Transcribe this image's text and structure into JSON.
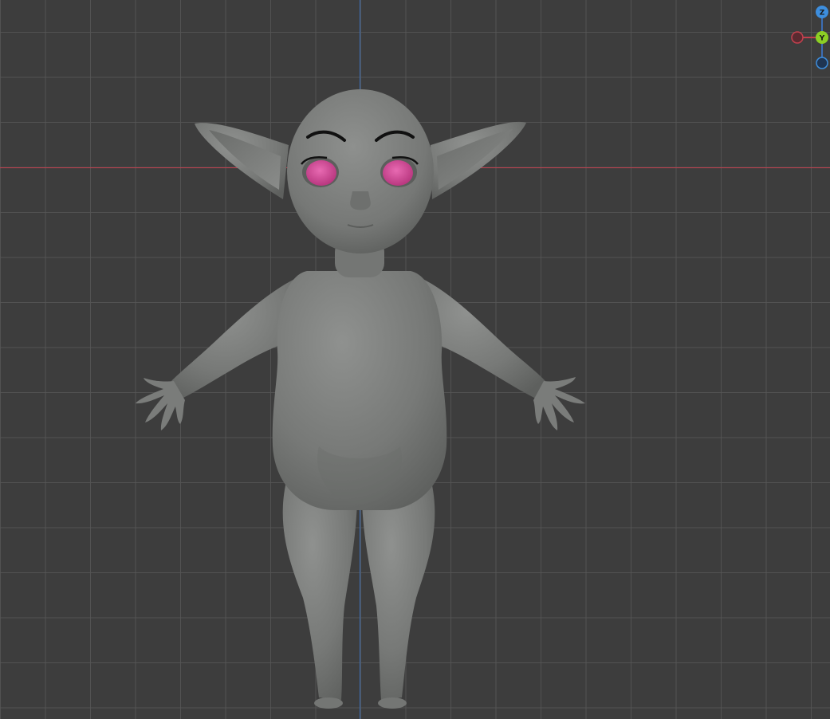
{
  "viewport": {
    "background_color": "#3d3d3d",
    "grid_line_color": "#565656",
    "x_axis_color": "#c2404e",
    "z_axis_color": "#3c6eb4"
  },
  "model": {
    "skin_color": "#7c7e7c",
    "eye_color": "#d8509e",
    "brow_color": "#111111"
  },
  "gizmo": {
    "z_label": "Z",
    "y_label": "Y",
    "z_color": "#3d8ede",
    "y_color": "#8ccf24",
    "x_color": "#c3404e"
  }
}
